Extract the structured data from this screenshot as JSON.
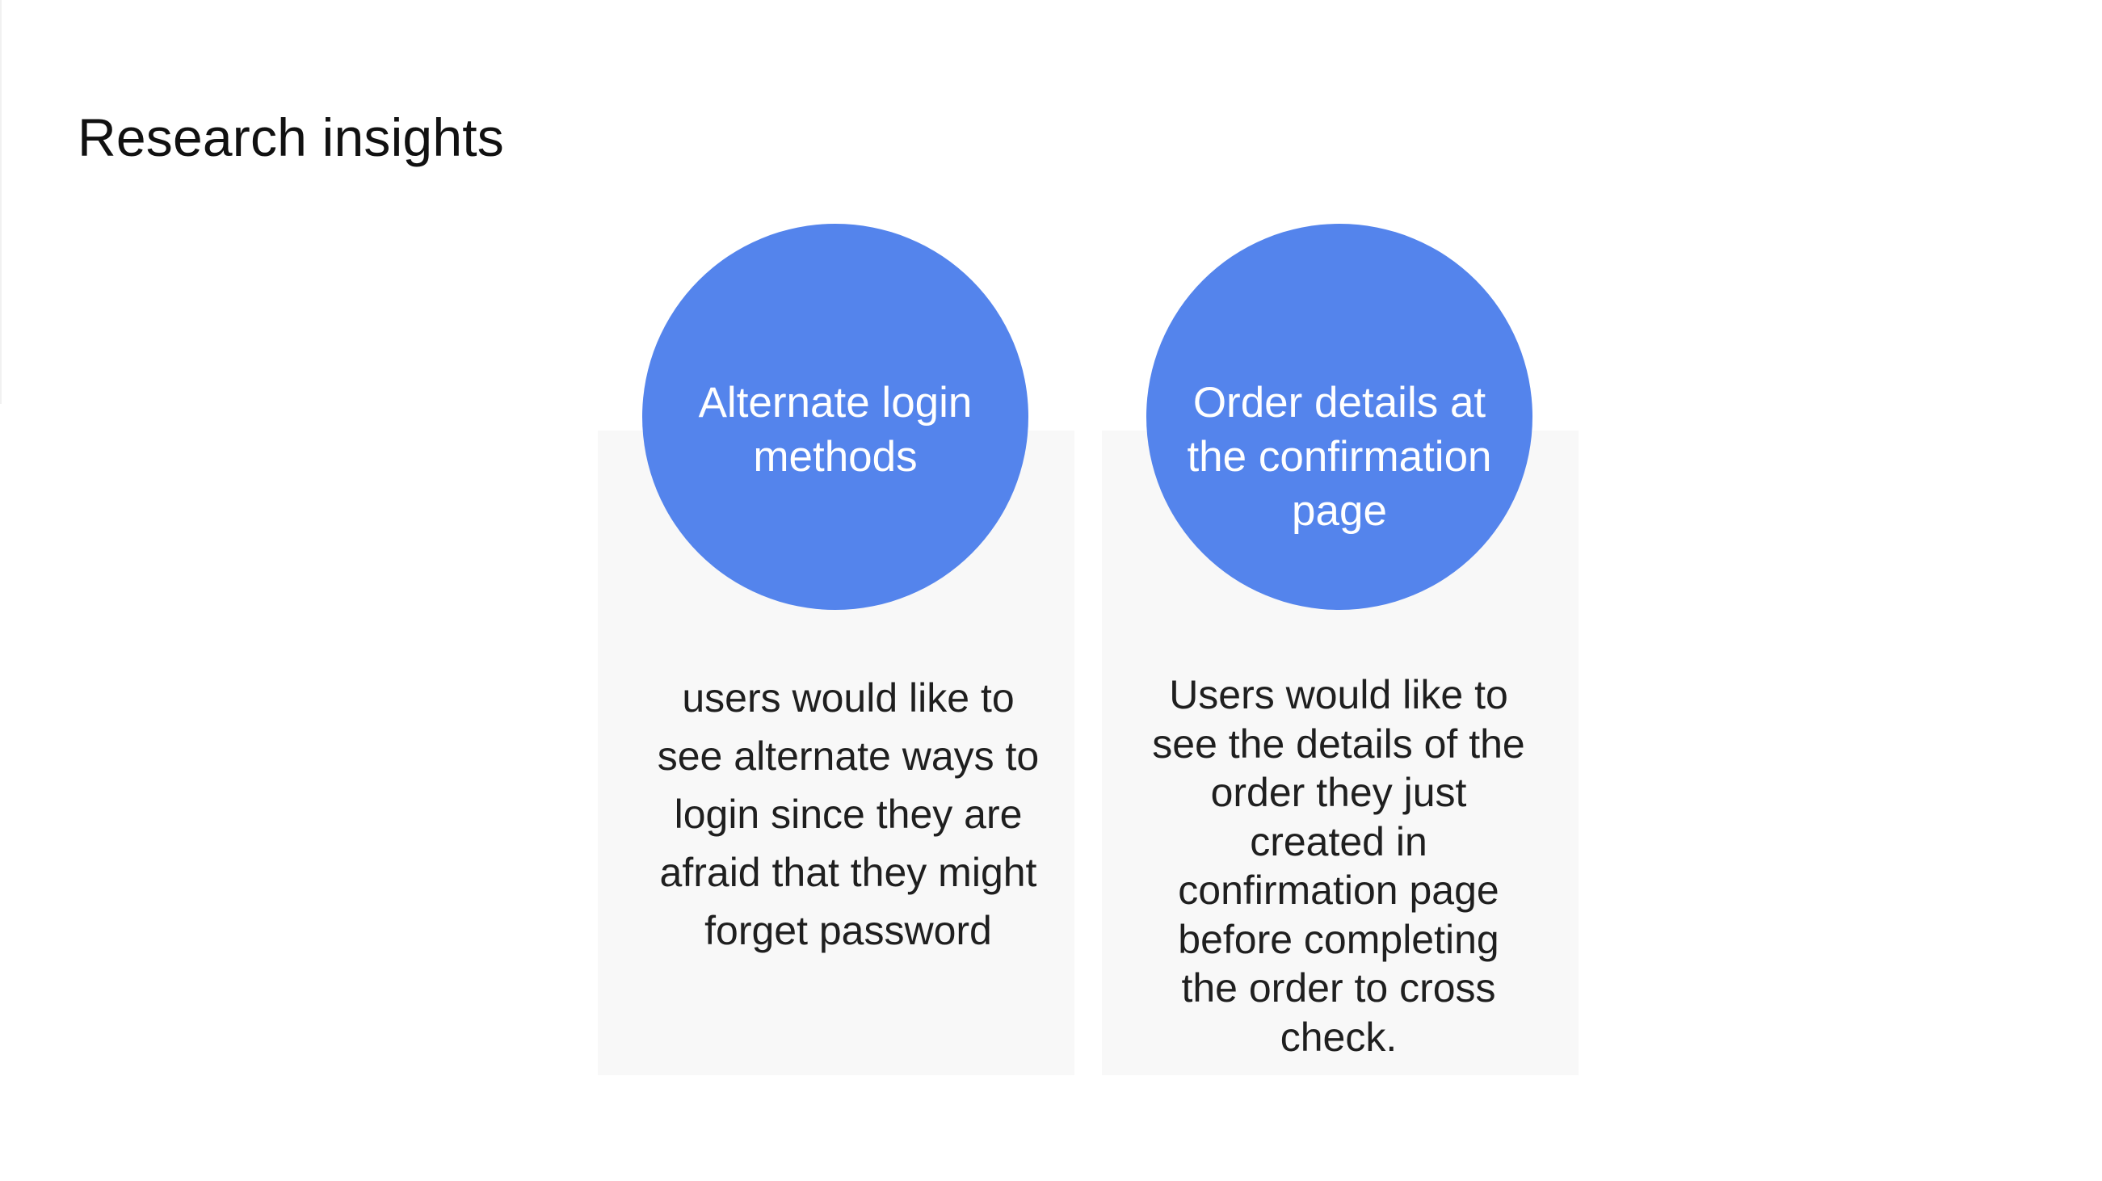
{
  "slide": {
    "title": "Research insights"
  },
  "insights": [
    {
      "heading": "Alternate login methods",
      "description": "users would like to see alternate ways to login since they are afraid that they might forget password"
    },
    {
      "heading": "Order details at the confirmation page",
      "description": "Users would like to see the details of the order they just created in confirmation page before completing the order to cross check."
    }
  ],
  "colors": {
    "circle": "#5484ec",
    "card": "#f8f8f8",
    "background": "#ffffff"
  }
}
